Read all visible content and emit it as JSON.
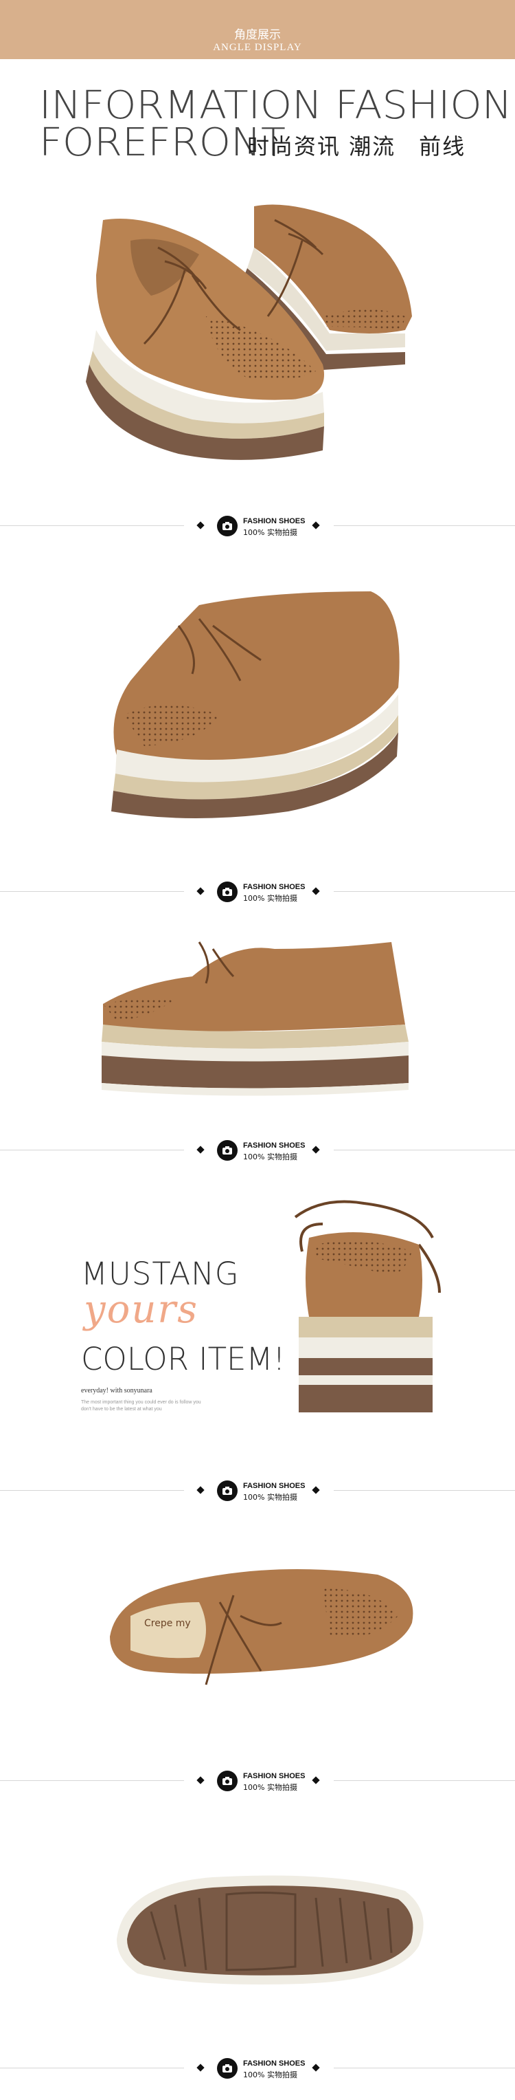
{
  "header": {
    "title_cn": "角度展示",
    "title_en": "ANGLE DISPLAY",
    "color": "#d8b08c"
  },
  "hero": {
    "line1": "INFORMATION FASHION",
    "line2": "FOREFRONT",
    "cn": "时尚资讯 潮流　前线"
  },
  "separator": {
    "title": "FASHION SHOES",
    "subtitle": "100% 实物拍摄",
    "icon": "camera-icon"
  },
  "promo": {
    "line1": "MUSTANG",
    "line2": "yours",
    "line3": "COLOR ITEM!",
    "tagline": "everyday! with sonyunara",
    "note": "The most important thing you could ever do is follow you don't have to be the latest at what you"
  },
  "insole_logo": "Crepe my",
  "colors": {
    "leather": "#b07a4c",
    "leather_dark": "#8a5a34",
    "sole_brown": "#7a5a46",
    "accent": "#f0a888"
  }
}
